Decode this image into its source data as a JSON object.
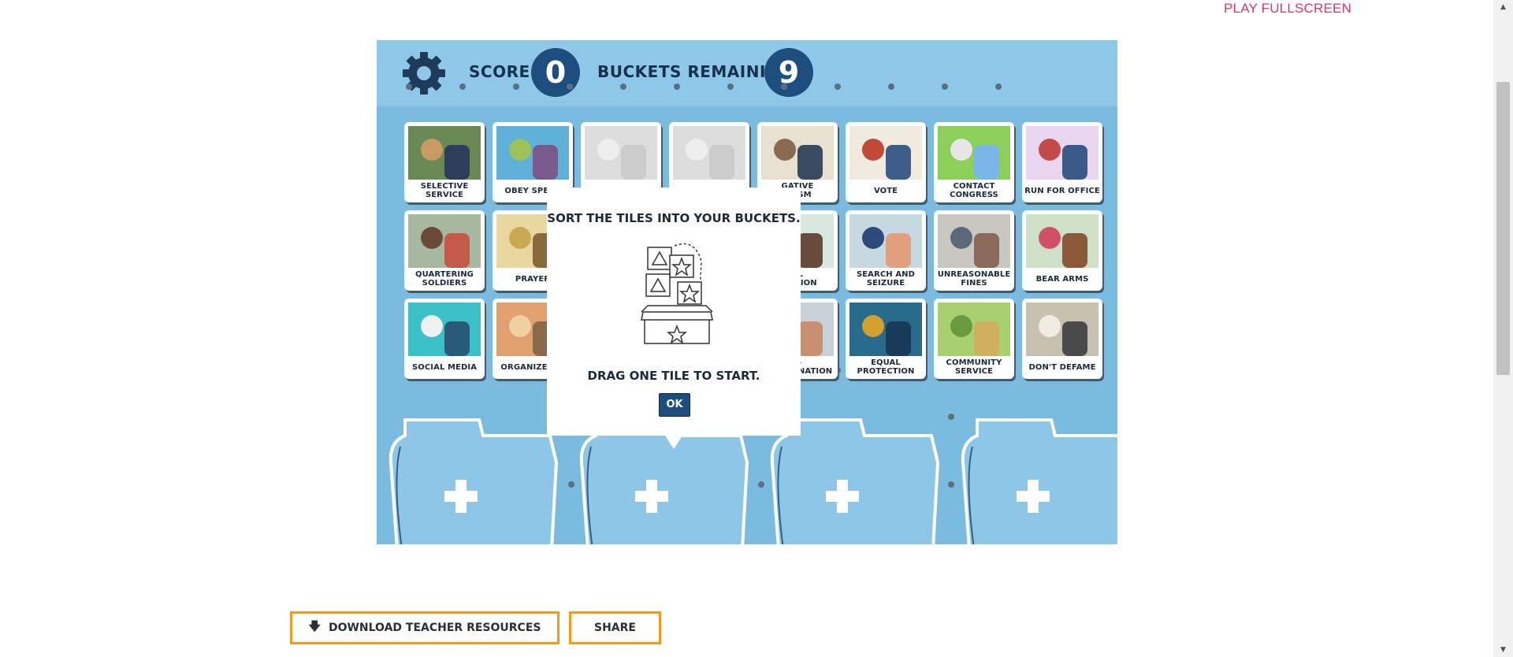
{
  "header": {
    "play_fullscreen": "PLAY FULLSCREEN"
  },
  "game": {
    "score_label": "SCORE:",
    "score": "0",
    "buckets_label": "BUCKETS REMAINING:",
    "buckets_remaining": "9"
  },
  "tiles": [
    {
      "label": "SELECTIVE SERVICE",
      "icon": "selective-service-icon"
    },
    {
      "label": "OBEY SPEED",
      "icon": "speed-limit-icon"
    },
    {
      "label": "",
      "icon": "hidden-tile"
    },
    {
      "label": "",
      "icon": "hidden-tile"
    },
    {
      "label": "GATIVE\nALISM",
      "icon": "investigative-journalism-icon"
    },
    {
      "label": "VOTE",
      "icon": "vote-icon"
    },
    {
      "label": "CONTACT CONGRESS",
      "icon": "capitol-icon"
    },
    {
      "label": "RUN FOR OFFICE",
      "icon": "podium-icon"
    },
    {
      "label": "QUARTERING SOLDIERS",
      "icon": "soldiers-icon"
    },
    {
      "label": "PRAYER",
      "icon": "religious-symbols-icon"
    },
    {
      "label": "",
      "icon": "hidden-tile"
    },
    {
      "label": "",
      "icon": "hidden-tile"
    },
    {
      "label": "AL\nNTATION",
      "icon": "representation-icon"
    },
    {
      "label": "SEARCH AND SEIZURE",
      "icon": "police-search-icon"
    },
    {
      "label": "UNREASONABLE FINES",
      "icon": "fines-icon"
    },
    {
      "label": "BEAR ARMS",
      "icon": "people-icon"
    },
    {
      "label": "SOCIAL MEDIA",
      "icon": "social-media-icon"
    },
    {
      "label": "ORGANIZED M",
      "icon": "crowd-icon"
    },
    {
      "label": "",
      "icon": "hidden-tile"
    },
    {
      "label": "",
      "icon": "hidden-tile"
    },
    {
      "label": "F-\nINCRIMINATION",
      "icon": "officer-icon"
    },
    {
      "label": "EQUAL PROTECTION",
      "icon": "justice-statue-icon"
    },
    {
      "label": "COMMUNITY SERVICE",
      "icon": "park-icon"
    },
    {
      "label": "DON'T DEFAME",
      "icon": "newspaper-icon"
    }
  ],
  "popup": {
    "title": "SORT THE TILES INTO YOUR BUCKETS.",
    "instruction": "DRAG ONE TILE TO START.",
    "ok": "OK"
  },
  "buckets": [
    {
      "icon": "plus-icon"
    },
    {
      "icon": "plus-icon"
    },
    {
      "icon": "plus-icon"
    },
    {
      "icon": "plus-icon"
    }
  ],
  "footer": {
    "download_label": "DOWNLOAD TEACHER RESOURCES",
    "share_label": "SHARE"
  },
  "colors": {
    "accent_orange": "#f39a1e",
    "navy": "#1e4e7e",
    "board_blue": "#7cbbe0",
    "link_pink": "#e0336b"
  }
}
